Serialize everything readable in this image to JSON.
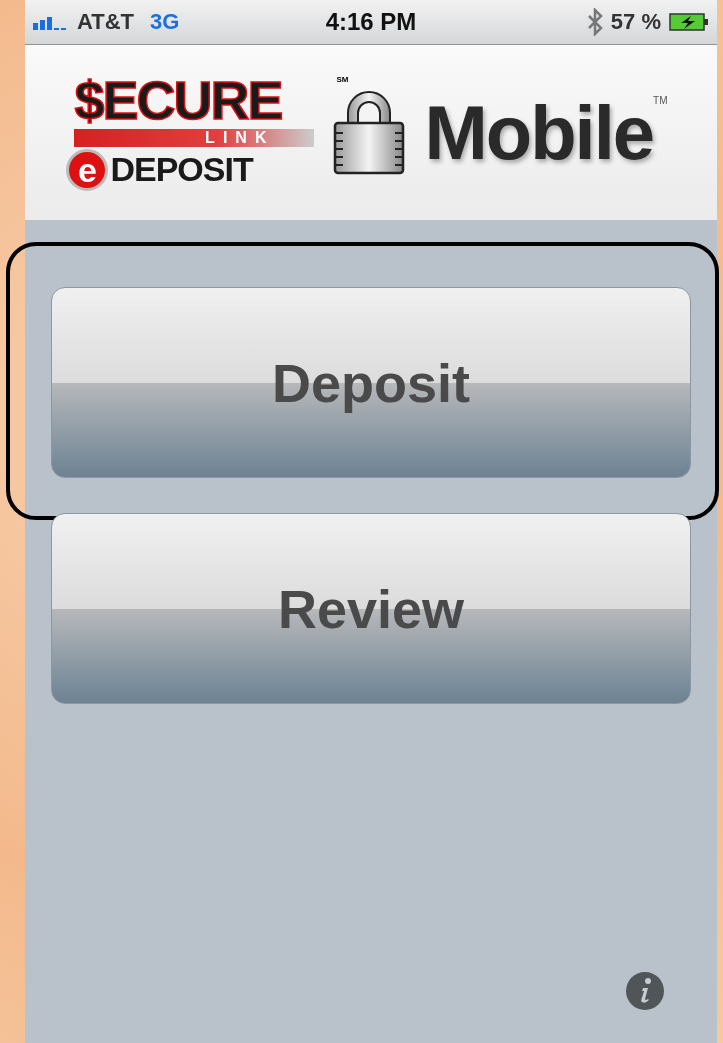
{
  "status_bar": {
    "carrier": "AT&T",
    "network": "3G",
    "time": "4:16 PM",
    "battery_percent": "57 %"
  },
  "logo": {
    "secure": "$ECURE",
    "link": "LINK",
    "service_mark": "SM",
    "e": "e",
    "deposit": "DEPOSIT",
    "mobile": "Mobile",
    "trademark": "TM"
  },
  "buttons": [
    {
      "label": "Deposit",
      "selected": true
    },
    {
      "label": "Review",
      "selected": false
    }
  ]
}
